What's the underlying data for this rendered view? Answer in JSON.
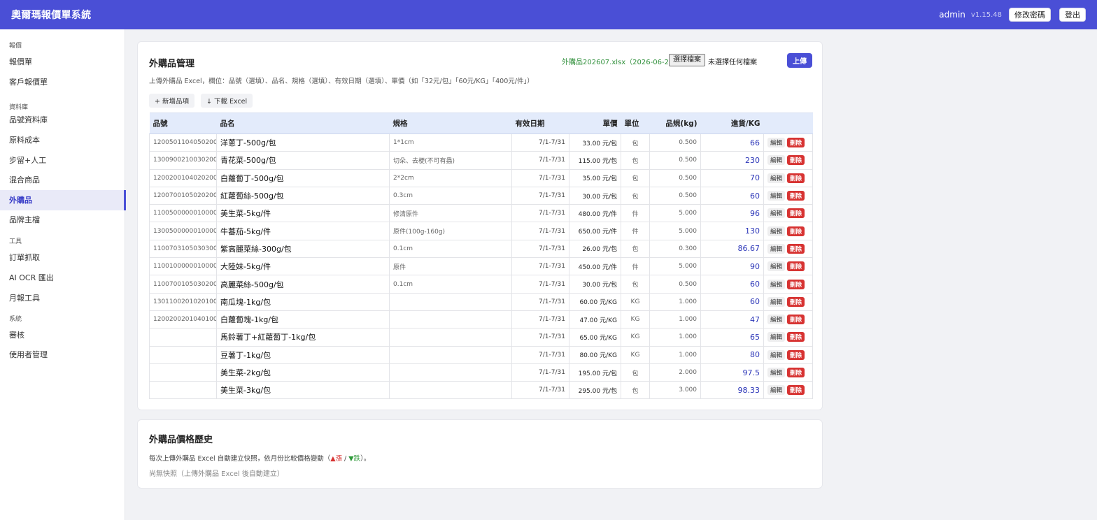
{
  "app": {
    "title": "奧爾瑪報價單系統",
    "user": "admin",
    "version": "v1.15.48",
    "change_password": "修改密碼",
    "logout": "登出"
  },
  "sidebar": {
    "groups": [
      {
        "label": "報價",
        "items": [
          "報價單",
          "客戶報價單"
        ]
      },
      {
        "label": "資料庫",
        "items": [
          "品號資料庫",
          "原料成本",
          "步留+人工",
          "混合商品",
          "外購品",
          "品牌主檔"
        ]
      },
      {
        "label": "工具",
        "items": [
          "訂單抓取",
          "AI OCR 匯出",
          "月報工具"
        ]
      },
      {
        "label": "系統",
        "items": [
          "審核",
          "使用者管理"
        ]
      }
    ],
    "active": "外購品"
  },
  "purchase": {
    "title": "外購品管理",
    "file_name": "外購品202607.xlsx（2026-06-23）",
    "choose_file": "選擇檔案",
    "no_file": "未選擇任何檔案",
    "upload": "上傳",
    "hint": "上傳外購品 Excel，欄位：品號（選填）、品名、規格（選填）、有效日期（選填）、單價（如「32元/包」「60元/KG」「400元/件」）",
    "add_item": "+ 新增品項",
    "download": "↓ 下載 Excel",
    "columns": [
      "品號",
      "品名",
      "規格",
      "有效日期",
      "單價",
      "單位",
      "品規(kg)",
      "進貨/KG",
      ""
    ],
    "edit_label": "編輯",
    "delete_label": "刪除",
    "rows": [
      [
        "1200501104050200",
        "洋蔥丁-500g/包",
        "1*1cm",
        "7/1-7/31",
        "33.00 元/包",
        "包",
        "0.500",
        "66"
      ],
      [
        "1300900210030200",
        "青花菜-500g/包",
        "切朵、去梗(不可有蟲)",
        "7/1-7/31",
        "115.00 元/包",
        "包",
        "0.500",
        "230"
      ],
      [
        "1200200104020200",
        "白蘿蔔丁-500g/包",
        "2*2cm",
        "7/1-7/31",
        "35.00 元/包",
        "包",
        "0.500",
        "70"
      ],
      [
        "1200700105020200",
        "紅蘿蔔絲-500g/包",
        "0.3cm",
        "7/1-7/31",
        "30.00 元/包",
        "包",
        "0.500",
        "60"
      ],
      [
        "1100500000010000",
        "美生菜-5kg/件",
        "修清原件",
        "7/1-7/31",
        "480.00 元/件",
        "件",
        "5.000",
        "96"
      ],
      [
        "1300500000010000",
        "牛蕃茄-5kg/件",
        "原件(100g-160g)",
        "7/1-7/31",
        "650.00 元/件",
        "件",
        "5.000",
        "130"
      ],
      [
        "1100703105030300",
        "紫高麗菜絲-300g/包",
        "0.1cm",
        "7/1-7/31",
        "26.00 元/包",
        "包",
        "0.300",
        "86.67"
      ],
      [
        "1100100000010000",
        "大陸妹-5kg/件",
        "原件",
        "7/1-7/31",
        "450.00 元/件",
        "件",
        "5.000",
        "90"
      ],
      [
        "1100700105030200",
        "高麗菜絲-500g/包",
        "0.1cm",
        "7/1-7/31",
        "30.00 元/包",
        "包",
        "0.500",
        "60"
      ],
      [
        "1301100201020100",
        "南瓜塊-1kg/包",
        "",
        "7/1-7/31",
        "60.00 元/KG",
        "KG",
        "1.000",
        "60"
      ],
      [
        "1200200201040100",
        "白蘿蔔塊-1kg/包",
        "",
        "7/1-7/31",
        "47.00 元/KG",
        "KG",
        "1.000",
        "47"
      ],
      [
        "",
        "馬鈴薯丁+紅蘿蔔丁-1kg/包",
        "",
        "7/1-7/31",
        "65.00 元/KG",
        "KG",
        "1.000",
        "65"
      ],
      [
        "",
        "豆薯丁-1kg/包",
        "",
        "7/1-7/31",
        "80.00 元/KG",
        "KG",
        "1.000",
        "80"
      ],
      [
        "",
        "美生菜-2kg/包",
        "",
        "7/1-7/31",
        "195.00 元/包",
        "包",
        "2.000",
        "97.5"
      ],
      [
        "",
        "美生菜-3kg/包",
        "",
        "7/1-7/31",
        "295.00 元/包",
        "包",
        "3.000",
        "98.33"
      ]
    ]
  },
  "history": {
    "title": "外購品價格歷史",
    "desc_before": "每次上傳外購品 Excel 自動建立快照，依月份比較價格變動（",
    "up": "▲漲",
    "sep": " / ",
    "down": "▼跌",
    "desc_after": "）。",
    "empty": "尚無快照（上傳外購品 Excel 後自動建立）"
  }
}
